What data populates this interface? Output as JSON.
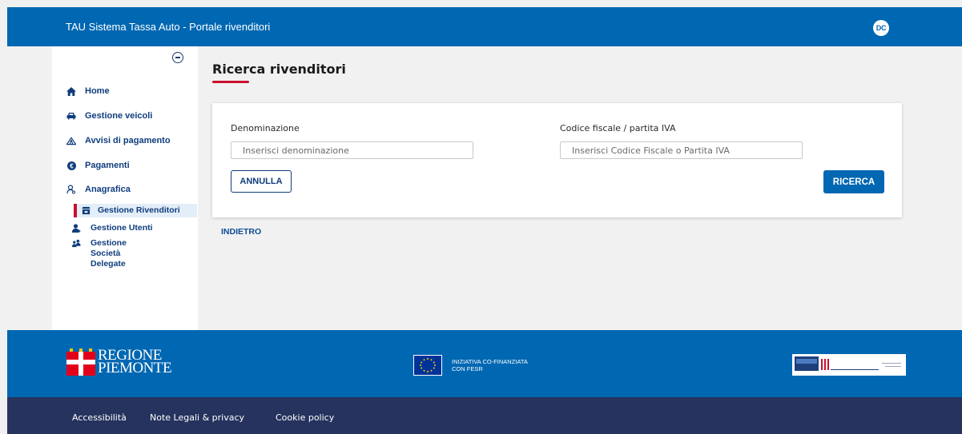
{
  "header": {
    "app_title": "TAU Sistema Tassa Auto - Portale rivenditori",
    "user_initials": "DC"
  },
  "sidebar": {
    "items": [
      {
        "label": "Home",
        "icon": "home-icon"
      },
      {
        "label": "Gestione veicoli",
        "icon": "car-icon"
      },
      {
        "label": "Avvisi di pagamento",
        "icon": "tent-icon"
      },
      {
        "label": "Pagamenti",
        "icon": "euro-coin-icon"
      },
      {
        "label": "Anagrafica",
        "icon": "user-search-icon"
      }
    ],
    "sub_items": [
      {
        "label": "Gestione Rivenditori",
        "icon": "store-icon",
        "active": true
      },
      {
        "label": "Gestione Utenti",
        "icon": "user-add-icon",
        "active": false
      },
      {
        "label": "Gestione Società Delegate",
        "icon": "group-icon",
        "active": false
      }
    ]
  },
  "main": {
    "title": "Ricerca rivenditori",
    "form": {
      "denominazione_label": "Denominazione",
      "denominazione_placeholder": "Inserisci denominazione",
      "codice_label": "Codice fiscale / partita IVA",
      "codice_placeholder": "Inserisci Codice Fiscale o Partita IVA",
      "cancel_label": "ANNULLA",
      "search_label": "RICERCA"
    },
    "back_label": "INDIETRO"
  },
  "footer": {
    "regione_line1": "REGIONE",
    "regione_line2": "PIEMONTE",
    "eu_line1": "INIZIATIVA CO-FINANZIATA",
    "eu_line2": "CON FESR",
    "links": [
      "Accessibilità",
      "Note Legali & privacy",
      "Cookie policy"
    ]
  },
  "colors": {
    "primary_blue": "#0067b2",
    "navy": "#26335e",
    "accent_red": "#c8102e",
    "nav_text": "#0f3d7d"
  }
}
